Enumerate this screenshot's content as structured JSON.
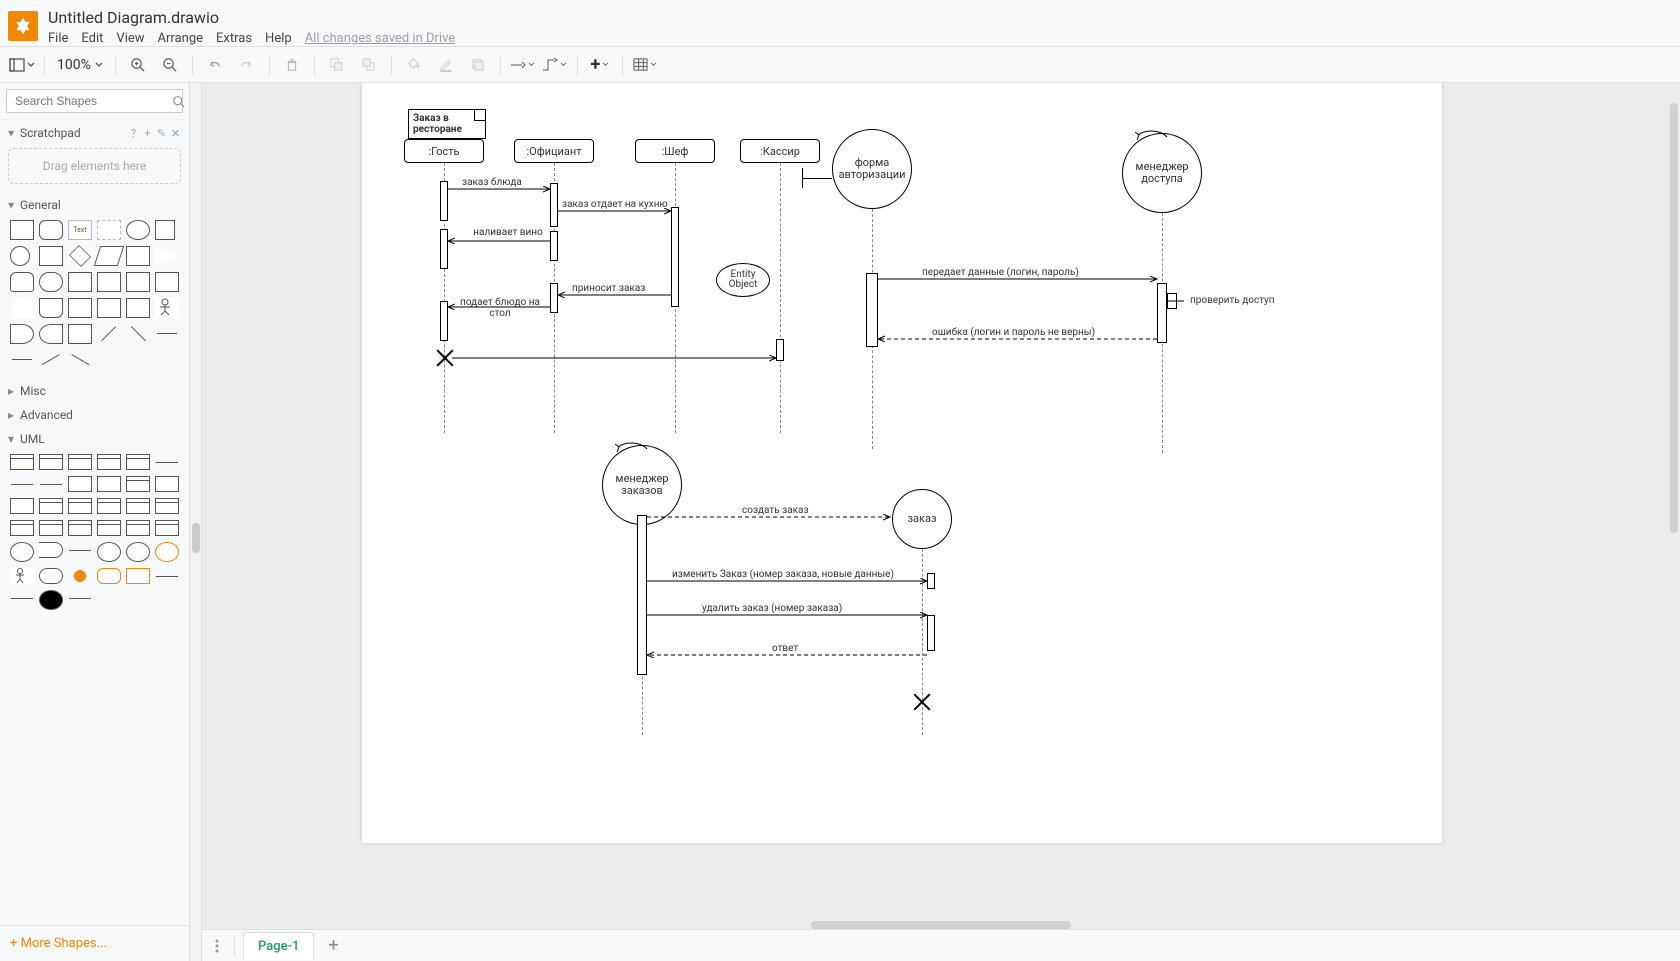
{
  "app": {
    "title": "Untitled Diagram.drawio",
    "save_status": "All changes saved in Drive"
  },
  "menu": {
    "file": "File",
    "edit": "Edit",
    "view": "View",
    "arrange": "Arrange",
    "extras": "Extras",
    "help": "Help"
  },
  "toolbar": {
    "zoom": "100%"
  },
  "sidebar": {
    "search_placeholder": "Search Shapes",
    "scratchpad": "Scratchpad",
    "scratchpad_hint": "Drag elements here",
    "sections": {
      "general": "General",
      "misc": "Misc",
      "advanced": "Advanced",
      "uml": "UML"
    },
    "more_shapes": "+ More Shapes..."
  },
  "tabs": {
    "page1": "Page-1"
  },
  "diagram": {
    "note_title": "Заказ в ресторане",
    "lifelines": {
      "guest": ":Гость",
      "waiter": ":Официант",
      "chef": ":Шеф",
      "cashier": ":Кассир"
    },
    "circles": {
      "auth": "форма авторизации",
      "access": "менеджер доступа",
      "orders": "менеджер заказов",
      "order": "заказ"
    },
    "entity": "Entity Object",
    "side": "проверить доступ",
    "messages": {
      "m1": "заказ блюда",
      "m2": "заказ отдает на кухню",
      "m3": "наливает вино",
      "m4": "приносит заказ",
      "m5": "подает блюдо на стол",
      "m6": "передает данные  (логин, пароль)",
      "m7": "ошибка (логин и пароль не верны)",
      "m8": "создать заказ",
      "m9": "изменить Заказ (номер заказа, новые данные)",
      "m10": "удалить заказ (номер заказа)",
      "m11": "ответ"
    }
  }
}
